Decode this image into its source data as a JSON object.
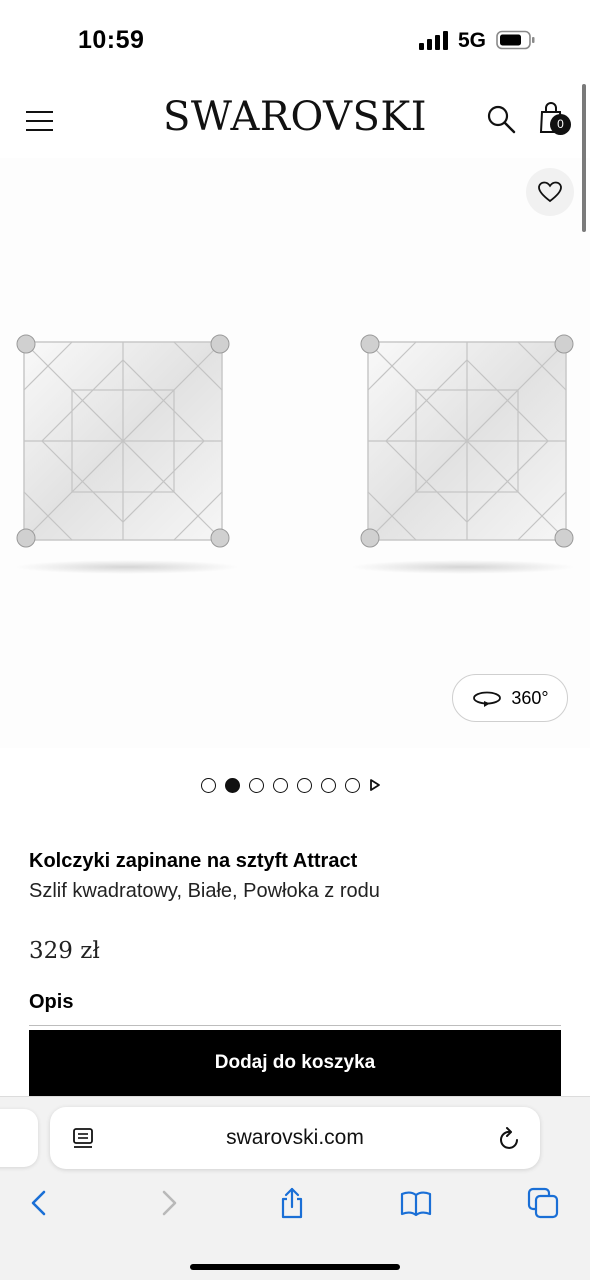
{
  "status_bar": {
    "time": "10:59",
    "network": "5G"
  },
  "header": {
    "brand": "SWAROVSKI",
    "cart_count": "0"
  },
  "gallery": {
    "rotate_label": "360°",
    "slide_count": 7,
    "active_slide": 2
  },
  "product": {
    "name": "Kolczyki zapinane na sztyft Attract",
    "subtitle": "Szlif kwadratowy, Białe, Powłoka z rodu",
    "price": "329 zł",
    "description_heading": "Opis",
    "add_to_cart_label": "Dodaj do koszyka"
  },
  "browser": {
    "url": "swarovski.com"
  },
  "colors": {
    "primary": "#000000",
    "background": "#ffffff",
    "toolbar_accent": "#1a6fd6",
    "toolbar_disabled": "#b9b9b9"
  }
}
